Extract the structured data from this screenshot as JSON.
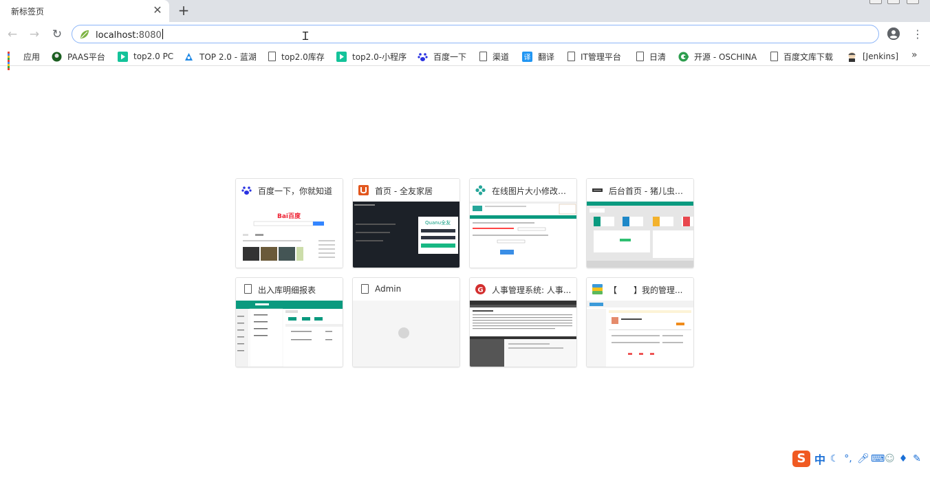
{
  "tab": {
    "title": "新标签页",
    "close_glyph": "✕",
    "new_tab_glyph": "+"
  },
  "toolbar": {
    "back_glyph": "←",
    "forward_glyph": "→",
    "reload_glyph": "↻",
    "url_host": "localhost:",
    "url_port": "8080",
    "menu_glyph": "⋮"
  },
  "bookmarks": {
    "items": [
      {
        "label": "应用",
        "icon": "apps-grid-icon"
      },
      {
        "label": "PAAS平台",
        "icon": "paas-logo-icon"
      },
      {
        "label": "top2.0 PC",
        "icon": "green-play-icon"
      },
      {
        "label": "TOP 2.0 - 蓝湖",
        "icon": "lanhu-icon"
      },
      {
        "label": "top2.0库存",
        "icon": "page-icon"
      },
      {
        "label": "top2.0-小程序",
        "icon": "green-play-icon"
      },
      {
        "label": "百度一下",
        "icon": "baidu-paw-icon"
      },
      {
        "label": "渠道",
        "icon": "page-icon"
      },
      {
        "label": "翻译",
        "icon": "translate-icon"
      },
      {
        "label": "IT管理平台",
        "icon": "page-icon"
      },
      {
        "label": "日清",
        "icon": "page-icon"
      },
      {
        "label": "开源 - OSCHINA",
        "icon": "oschina-icon"
      },
      {
        "label": "百度文库下载",
        "icon": "page-icon"
      },
      {
        "label": "[Jenkins]",
        "icon": "jenkins-icon"
      }
    ],
    "more_glyph": "»"
  },
  "tiles": [
    {
      "title": "百度一下，你就知道",
      "icon": "baidu-paw-icon"
    },
    {
      "title": "首页 - 全友家居",
      "icon": "quanu-u-icon"
    },
    {
      "title": "在线图片大小修改器...",
      "icon": "gear-flower-icon"
    },
    {
      "title": "后台首页 - 猪儿虫技...",
      "icon": "admin-logo-icon"
    },
    {
      "title": "出入库明细报表",
      "icon": "page-icon"
    },
    {
      "title": "Admin",
      "icon": "page-icon"
    },
    {
      "title": "人事管理系统: 人事...",
      "icon": "red-g-icon"
    },
    {
      "title": "【　　】我的管理...",
      "icon": "colorful-app-icon"
    }
  ],
  "thumbnails": {
    "baidu_logo": "Bai百度",
    "quanu_logo": "Quanu全友"
  },
  "ime": {
    "logo": "S",
    "lang": "中"
  },
  "colors": {
    "tabstrip": "#dee1e6",
    "omnibox_border": "#8ab4f8",
    "teal": "#0a9a7f",
    "sogou_orange": "#f05a22"
  }
}
